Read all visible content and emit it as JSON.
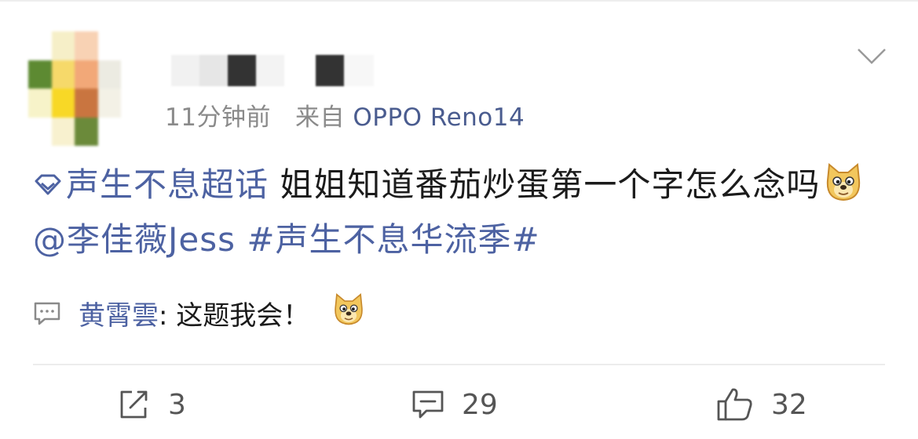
{
  "post": {
    "time": "11分钟前",
    "source_prefix": "来自",
    "device": "OPPO Reno14",
    "supertopic": "声生不息超话",
    "text": " 姐姐知道番茄炒蛋第一个字怎么念吗",
    "mention": "@李佳薇Jess",
    "hashtag": "#声生不息华流季#"
  },
  "featured_reply": {
    "user": "黄霄雲",
    "text": ": 这题我会！"
  },
  "actions": {
    "repost_count": "3",
    "comment_count": "29",
    "like_count": "32"
  },
  "colors": {
    "link": "#4d62a2",
    "meta": "#8a8a8a",
    "icon": "#555555"
  },
  "icons": {
    "supertopic": "diamond-icon",
    "emoji": "doge-emoji",
    "reply": "comment-bubble-icon",
    "repost": "share-icon",
    "comment": "comment-icon",
    "like": "thumbs-up-icon",
    "more": "chevron-down-icon"
  }
}
